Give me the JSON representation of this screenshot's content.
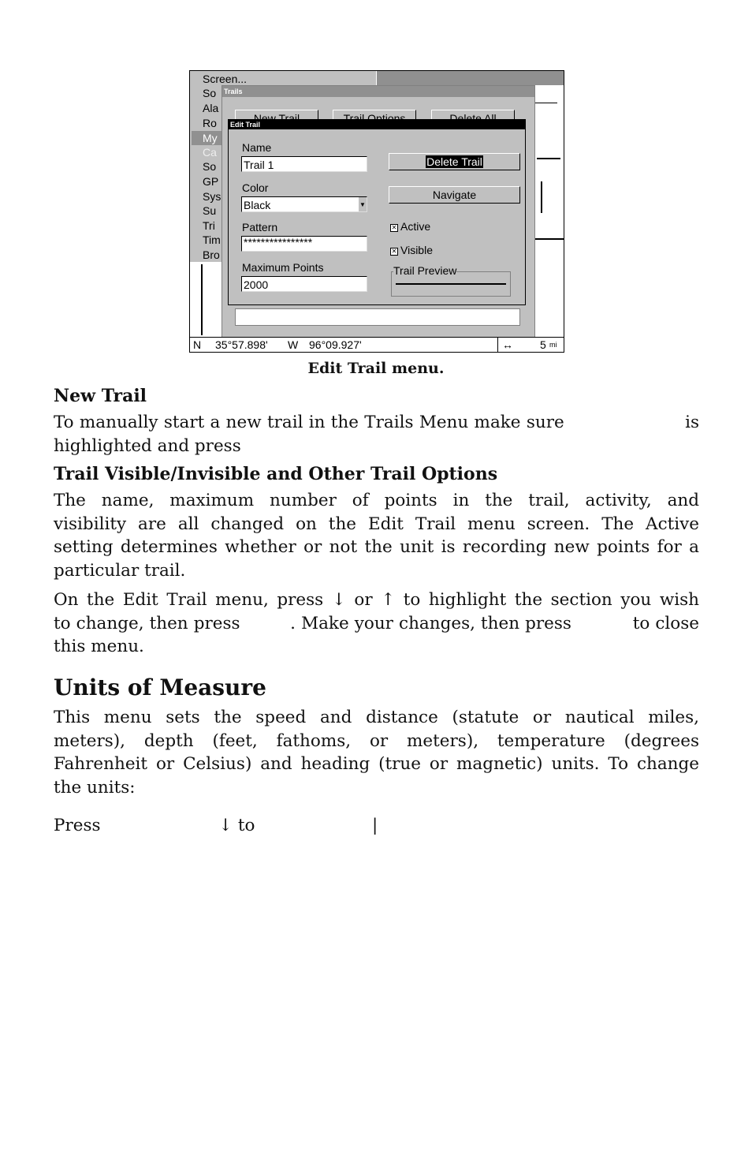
{
  "screenshot": {
    "menu_items": [
      "Screen...",
      "So",
      "Ala",
      "Ro",
      "My",
      "Ca",
      "So",
      "GP",
      "Sys",
      "Su",
      "Tri",
      "Tim",
      "Bro"
    ],
    "trails_window": {
      "title": "Trails",
      "buttons": [
        "New Trail",
        "Trail Options",
        "Delete All"
      ]
    },
    "edit_trail": {
      "title": "Edit Trail",
      "name_label": "Name",
      "name_value": "Trail 1",
      "color_label": "Color",
      "color_value": "Black",
      "pattern_label": "Pattern",
      "pattern_value": "****************",
      "max_points_label": "Maximum Points",
      "max_points_value": "2000",
      "delete_button": "Delete Trail",
      "navigate_button": "Navigate",
      "active_label": "Active",
      "active_checked": true,
      "visible_label": "Visible",
      "visible_checked": true,
      "preview_label": "Trail Preview"
    },
    "status": {
      "lat_hem": "N",
      "lat": "35°57.898'",
      "lon_hem": "W",
      "lon": "96°09.927'",
      "scale_icon": "↔",
      "scale": "5",
      "scale_unit": "mi"
    }
  },
  "caption": "Edit Trail menu.",
  "sections": [
    {
      "heading": "New Trail",
      "lines": [
        "To manually start a new trail in the Trails Menu make sure                     is",
        "highlighted and press"
      ]
    },
    {
      "heading": "Trail Visible/Invisible and Other Trail Options",
      "lines": [
        "The name, maximum number of points in the trail, activity, and",
        "visibility are all changed on the Edit Trail menu screen. The Active",
        "setting determines whether or not the unit is recording new points for a",
        "particular trail."
      ]
    },
    {
      "lines": [
        "On the Edit Trail menu, press ↓ or ↑ to highlight the section you wish",
        "to change, then press         . Make your changes, then press           to close",
        "this menu."
      ]
    }
  ],
  "units": {
    "heading": "Units of Measure",
    "lines": [
      "This menu sets the speed and distance (statute or nautical miles,",
      "meters), depth (feet, fathoms, or meters), temperature (degrees",
      "Fahrenheit or Celsius) and heading (true or magnetic) units. To change",
      "the units:"
    ],
    "press_line": [
      "Press",
      "↓ to",
      "|"
    ]
  }
}
